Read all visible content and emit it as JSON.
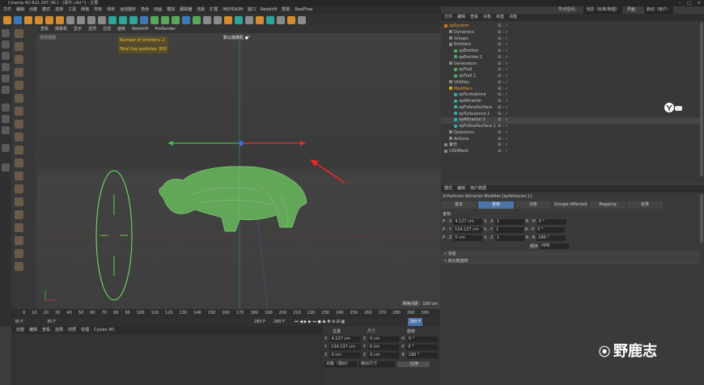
{
  "window": {
    "title": "Cinema 4D R21.207 (RC) - [犀牛.c4d *] - 主要",
    "btn_min": "–",
    "btn_max": "□",
    "btn_close": "✕"
  },
  "menubar": [
    "文件",
    "编辑",
    "创建",
    "模式",
    "选择",
    "工具",
    "网格",
    "样条",
    "体积",
    "运动图形",
    "角色",
    "动画",
    "模拟",
    "跟踪器",
    "渲染",
    "扩展",
    "INSYDIUM",
    "窗口",
    "Redshift",
    "帮助",
    "RealFlow"
  ],
  "viewport": {
    "menu": [
      "查看",
      "摄像机",
      "显示",
      "选项",
      "过滤",
      "面板",
      "Redshift",
      "ProRender"
    ],
    "label": "透视视图",
    "hud_emitters": "Number of emitters: 2",
    "hud_particles": "Total live particles: 900",
    "camera": "默认摄像机 ●°",
    "grid_info": "网格间距：100 cm"
  },
  "timeline": {
    "ticks": [
      "0",
      "10",
      "20",
      "30",
      "40",
      "50",
      "60",
      "70",
      "80",
      "90",
      "100",
      "110",
      "120",
      "130",
      "140",
      "150",
      "160",
      "170",
      "180",
      "190",
      "200",
      "210",
      "220",
      "230",
      "240",
      "250",
      "260",
      "270",
      "280",
      "290",
      "300"
    ],
    "start": "30 F",
    "start2": "30 F",
    "end": "280 F",
    "end2": "280 F",
    "current": "280 F"
  },
  "anim_menu": [
    "创建",
    "编辑",
    "查看",
    "选择",
    "材质",
    "纹理",
    "Cycles 4D"
  ],
  "coords": {
    "headers": [
      "位置",
      "尺寸",
      "旋转"
    ],
    "rows": [
      {
        "a": "X",
        "v1": "4.127 cm",
        "b": "X",
        "v2": "0 cm",
        "c": "H",
        "v3": "0 °"
      },
      {
        "a": "Y",
        "v1": "134.137 cm",
        "b": "Y",
        "v2": "0 cm",
        "c": "P",
        "v3": "0 °"
      },
      {
        "a": "Z",
        "v1": "0 cm",
        "b": "Z",
        "v2": "0 cm",
        "c": "B",
        "v3": "180 °"
      }
    ],
    "mode": "对象（相对）",
    "size_mode": "绝对尺寸",
    "apply": "应用"
  },
  "topright": {
    "layout_label": "节点空间：",
    "layout": "当前（标准/物理）",
    "interface_label": "界面：",
    "interface": "启动（用户）"
  },
  "obj_menu": [
    "文件",
    "编辑",
    "查看",
    "对象",
    "标签",
    "书签"
  ],
  "objects": [
    {
      "name": "xpSystem",
      "indent": 0,
      "color": "o",
      "sel": false
    },
    {
      "name": "Dynamics",
      "indent": 1,
      "color": "",
      "sel": false
    },
    {
      "name": "Groups",
      "indent": 1,
      "color": "",
      "sel": false
    },
    {
      "name": "Emitters",
      "indent": 1,
      "color": "",
      "sel": false
    },
    {
      "name": "xpEmitter",
      "indent": 2,
      "color": "g",
      "sel": false
    },
    {
      "name": "xpEmitter.1",
      "indent": 2,
      "color": "g",
      "sel": false
    },
    {
      "name": "Generators",
      "indent": 1,
      "color": "",
      "sel": false
    },
    {
      "name": "xpTrail",
      "indent": 2,
      "color": "g",
      "sel": false
    },
    {
      "name": "xpTrail.1",
      "indent": 2,
      "color": "g",
      "sel": false
    },
    {
      "name": "Utilities",
      "indent": 1,
      "color": "",
      "sel": false
    },
    {
      "name": "Modifiers",
      "indent": 1,
      "color": "y",
      "sel": false
    },
    {
      "name": "xpTurbulence",
      "indent": 2,
      "color": "c",
      "sel": false
    },
    {
      "name": "xpAttractor",
      "indent": 2,
      "color": "c",
      "sel": false
    },
    {
      "name": "xpFollowSurface",
      "indent": 2,
      "color": "c",
      "sel": false
    },
    {
      "name": "xpTurbulence.1",
      "indent": 2,
      "color": "c",
      "sel": false
    },
    {
      "name": "xpAttractor.1",
      "indent": 2,
      "color": "c",
      "sel": true
    },
    {
      "name": "xpFollowSurface.1",
      "indent": 2,
      "color": "c",
      "sel": false
    },
    {
      "name": "Questions",
      "indent": 1,
      "color": "",
      "sel": false
    },
    {
      "name": "Actions",
      "indent": 1,
      "color": "",
      "sel": false
    },
    {
      "name": "备份",
      "indent": 0,
      "color": "",
      "sel": false
    },
    {
      "name": "USDMesh",
      "indent": 0,
      "color": "",
      "sel": false
    }
  ],
  "attr_menu": [
    "模式",
    "编辑",
    "用户数据"
  ],
  "attr": {
    "title": "X-Particles Attractor Modifier [xpAttractor.1]",
    "tabs": [
      "基本",
      "坐标",
      "对象",
      "Groups Affected",
      "Mapping",
      "效果"
    ],
    "section": "坐标",
    "rows": [
      {
        "l1": "P . X",
        "v1": "4.127 cm",
        "l2": "S . X",
        "v2": "1",
        "l3": "R . H",
        "v3": "0 °"
      },
      {
        "l1": "P . Y",
        "v1": "134.137 cm",
        "l2": "S . Y",
        "v2": "1",
        "l3": "R . P",
        "v3": "0 °"
      },
      {
        "l1": "P . Z",
        "v1": "0 cm",
        "l2": "S . Z",
        "v2": "1",
        "l3": "R . B",
        "v3": "180 °"
      }
    ],
    "order_label": "顺序",
    "order": "HPB",
    "freeze": "• 冻结",
    "quat": "• 四元数旋转"
  },
  "watermark": "野鹿志",
  "colors": {
    "accent": "#4c73a8",
    "particles": "#7dfa6a",
    "hud": "#e6c23a",
    "red_axis": "#e03030",
    "green_axis": "#3fc04a"
  }
}
